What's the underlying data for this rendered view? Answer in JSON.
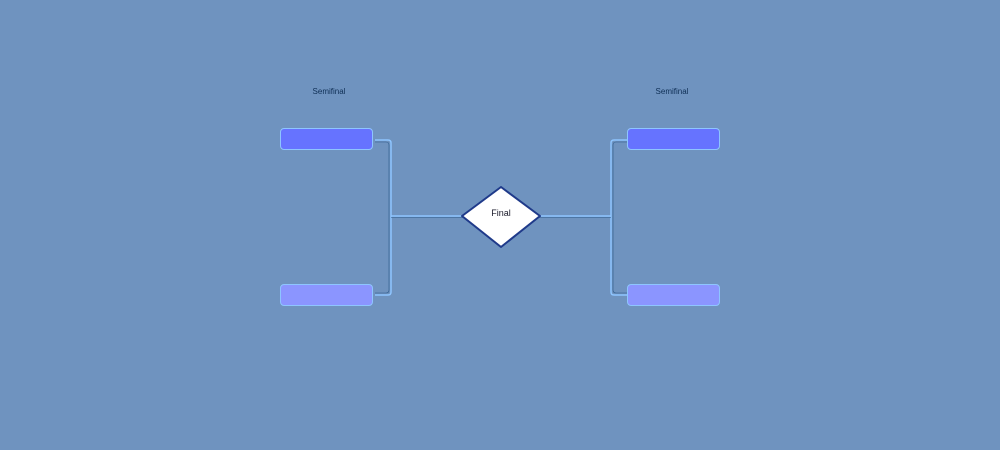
{
  "bracket": {
    "left_round_label": "Semifinal",
    "right_round_label": "Semifinal",
    "final_label": "Final"
  },
  "colors": {
    "background": "#6f93bf",
    "team_top_fill": "#6673ff",
    "team_bottom_fill": "#8b95ff",
    "box_border": "#8ec5ff",
    "connector": "#8ec5ff",
    "final_fill": "#ffffff",
    "final_border": "#1f3a8a"
  }
}
